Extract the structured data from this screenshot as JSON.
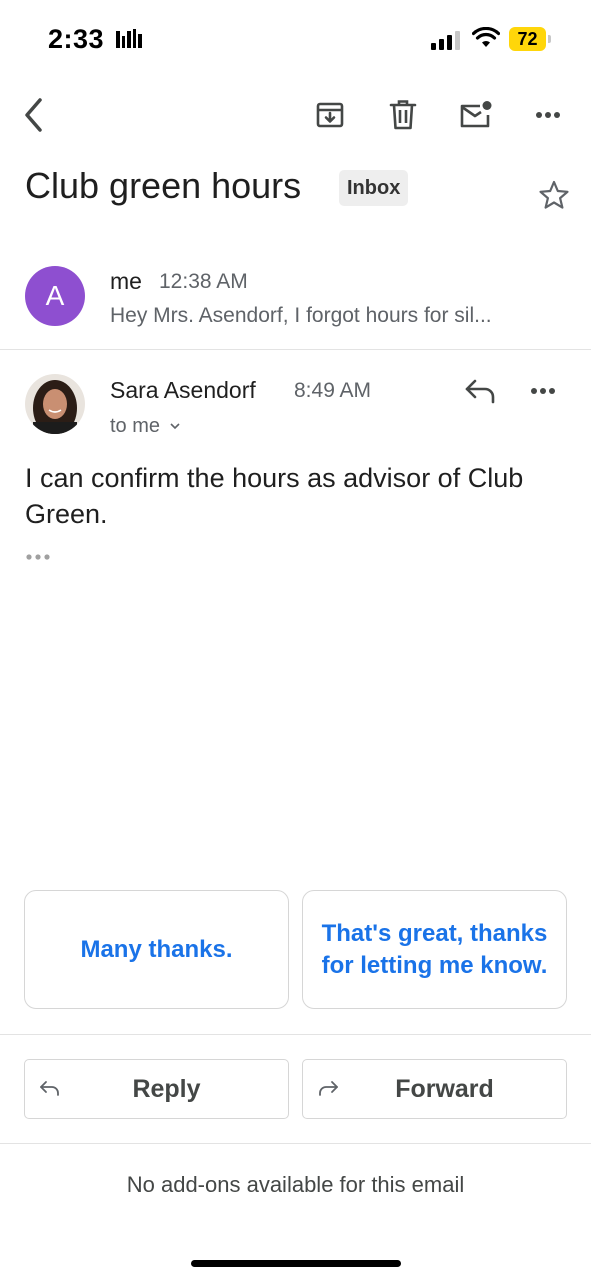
{
  "status_bar": {
    "time": "2:33",
    "battery": "72",
    "battery_color": "#ffd60a"
  },
  "toolbar": {
    "back_icon": "chevron-left-icon",
    "archive_icon": "archive-icon",
    "delete_icon": "trash-icon",
    "mark_unread_icon": "mail-unread-icon",
    "more_icon": "more-horizontal-icon"
  },
  "thread": {
    "subject": "Club green hours",
    "label": "Inbox"
  },
  "messages": [
    {
      "avatar_letter": "A",
      "avatar_color": "#8e4fd0",
      "sender": "me",
      "time": "12:38 AM",
      "snippet": "Hey Mrs. Asendorf, I forgot hours for sil..."
    },
    {
      "sender": "Sara Asendorf",
      "time": "8:49 AM",
      "recipient": "to me",
      "body": "I can confirm the hours as advisor of Club Green."
    }
  ],
  "smart_replies": [
    "Many thanks.",
    "That's great, thanks for letting me know."
  ],
  "actions": {
    "reply": "Reply",
    "forward": "Forward"
  },
  "footer": {
    "addons": "No add-ons available for this email"
  },
  "accent_color": "#1a73e8"
}
